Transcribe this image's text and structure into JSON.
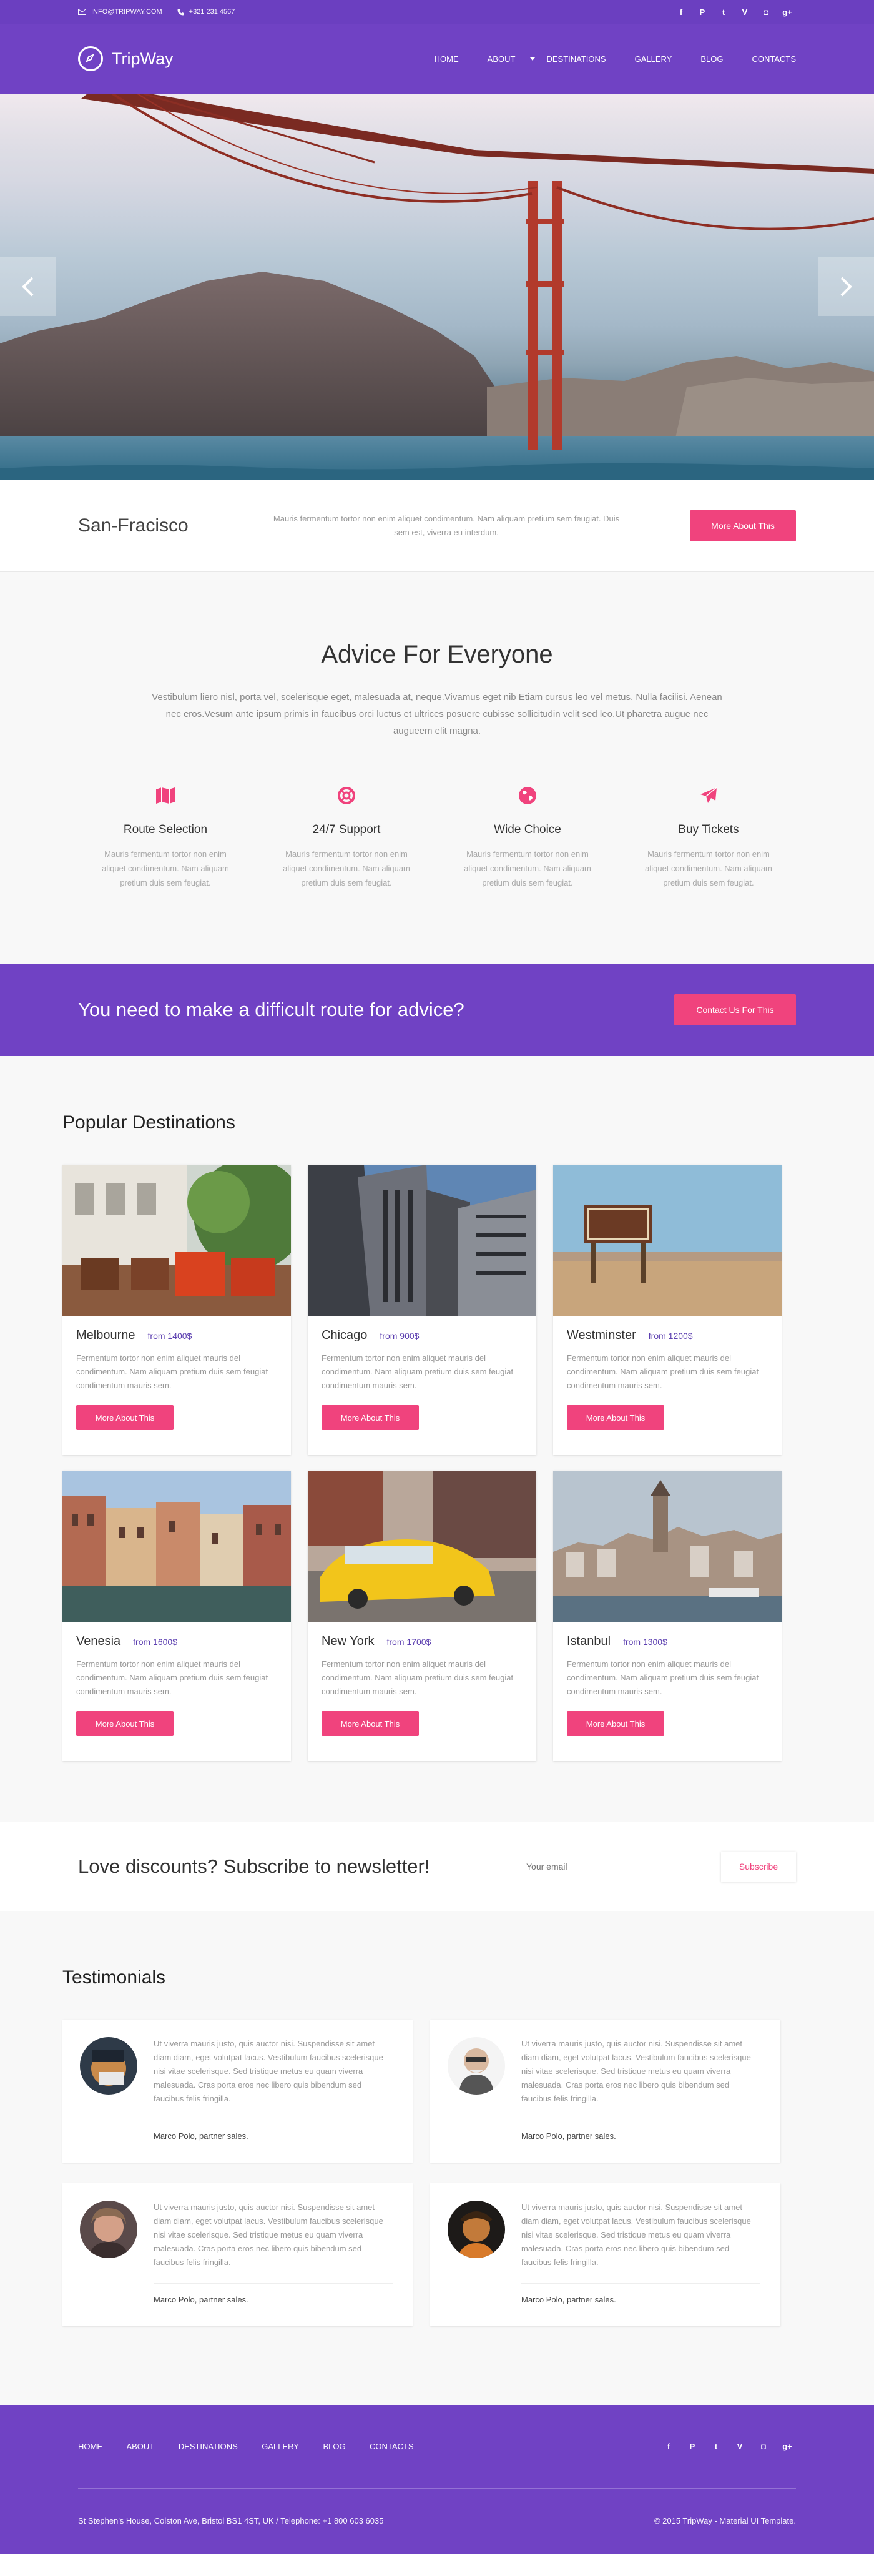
{
  "topbar": {
    "email": "INFO@TRIPWAY.COM",
    "phone": "+321 231 4567",
    "social": [
      {
        "icon": "facebook-icon",
        "glyph": "f"
      },
      {
        "icon": "pinterest-icon",
        "glyph": "P"
      },
      {
        "icon": "twitter-icon",
        "glyph": "t"
      },
      {
        "icon": "vimeo-icon",
        "glyph": "V"
      },
      {
        "icon": "instagram-icon",
        "glyph": "◘"
      },
      {
        "icon": "google-plus-icon",
        "glyph": "g+"
      }
    ]
  },
  "header": {
    "brand": "TripWay",
    "nav": [
      "HOME",
      "ABOUT",
      "DESTINATIONS",
      "GALLERY",
      "BLOG",
      "CONTACTS"
    ]
  },
  "hero": {
    "prev_icon": "chevron-left-icon",
    "next_icon": "chevron-right-icon"
  },
  "city": {
    "name": "San-Fracisco",
    "description": "Mauris fermentum tortor non enim aliquet condimentum. Nam aliquam pretium sem feugiat. Duis sem est, viverra eu interdum.",
    "button": "More About This"
  },
  "advice": {
    "title": "Advice For Everyone",
    "lead": "Vestibulum liero nisl, porta vel, scelerisque eget, malesuada at, neque.Vivamus eget nib Etiam cursus leo vel metus. Nulla facilisi. Aenean nec eros.Vesum ante ipsum primis in faucibus orci luctus et ultrices posuere cubisse sollicitudin velit sed leo.Ut pharetra augue nec augueem elit magna.",
    "features": [
      {
        "icon": "map-icon",
        "title": "Route Selection",
        "text": "Mauris fermentum tortor non enim aliquet condimentum. Nam aliquam pretium duis sem feugiat."
      },
      {
        "icon": "lifebuoy-icon",
        "title": "24/7 Support",
        "text": "Mauris fermentum tortor non enim aliquet condimentum. Nam aliquam pretium duis sem feugiat."
      },
      {
        "icon": "globe-icon",
        "title": "Wide Choice",
        "text": "Mauris fermentum tortor non enim aliquet condimentum. Nam aliquam pretium duis sem feugiat."
      },
      {
        "icon": "airplane-icon",
        "title": "Buy Tickets",
        "text": "Mauris fermentum tortor non enim aliquet condimentum. Nam aliquam pretium duis sem feugiat."
      }
    ]
  },
  "callout": {
    "title": "You need to make a difficult route for advice?",
    "button": "Contact Us For This"
  },
  "destinations": {
    "title": "Popular Destinations",
    "items": [
      {
        "name": "Melbourne",
        "price": "from 1400$",
        "text": "Fermentum tortor non enim aliquet mauris del condimentum. Nam aliquam pretium duis sem feugiat condimentum mauris sem.",
        "button": "More About This"
      },
      {
        "name": "Chicago",
        "price": "from 900$",
        "text": "Fermentum tortor non enim aliquet mauris del condimentum. Nam aliquam pretium duis sem feugiat condimentum mauris sem.",
        "button": "More About This"
      },
      {
        "name": "Westminster",
        "price": "from 1200$",
        "text": "Fermentum tortor non enim aliquet mauris del condimentum. Nam aliquam pretium duis sem feugiat condimentum mauris sem.",
        "button": "More About This"
      },
      {
        "name": "Venesia",
        "price": "from 1600$",
        "text": "Fermentum tortor non enim aliquet mauris del condimentum. Nam aliquam pretium duis sem feugiat condimentum mauris sem.",
        "button": "More About This"
      },
      {
        "name": "New York",
        "price": "from 1700$",
        "text": "Fermentum tortor non enim aliquet mauris del condimentum. Nam aliquam pretium duis sem feugiat condimentum mauris sem.",
        "button": "More About This"
      },
      {
        "name": "Istanbul",
        "price": "from 1300$",
        "text": "Fermentum tortor non enim aliquet mauris del condimentum. Nam aliquam pretium duis sem feugiat condimentum mauris sem.",
        "button": "More About This"
      }
    ]
  },
  "newsletter": {
    "title": "Love discounts? Subscribe to newsletter!",
    "placeholder": "Your email",
    "button": "Subscribe"
  },
  "testimonials": {
    "title": "Testimonials",
    "items": [
      {
        "text": "Ut viverra mauris justo, quis auctor nisi. Suspendisse sit amet diam diam, eget volutpat lacus. Vestibulum faucibus scelerisque nisi vitae scelerisque. Sed tristique metus eu quam viverra malesuada. Cras porta eros nec libero quis bibendum sed faucibus felis fringilla.",
        "author": "Marco Polo, partner sales."
      },
      {
        "text": "Ut viverra mauris justo, quis auctor nisi. Suspendisse sit amet diam diam, eget volutpat lacus. Vestibulum faucibus scelerisque nisi vitae scelerisque. Sed tristique metus eu quam viverra malesuada. Cras porta eros nec libero quis bibendum sed faucibus felis fringilla.",
        "author": "Marco Polo, partner sales."
      },
      {
        "text": "Ut viverra mauris justo, quis auctor nisi. Suspendisse sit amet diam diam, eget volutpat lacus. Vestibulum faucibus scelerisque nisi vitae scelerisque. Sed tristique metus eu quam viverra malesuada. Cras porta eros nec libero quis bibendum sed faucibus felis fringilla.",
        "author": "Marco Polo, partner sales."
      },
      {
        "text": "Ut viverra mauris justo, quis auctor nisi. Suspendisse sit amet diam diam, eget volutpat lacus. Vestibulum faucibus scelerisque nisi vitae scelerisque. Sed tristique metus eu quam viverra malesuada. Cras porta eros nec libero quis bibendum sed faucibus felis fringilla.",
        "author": "Marco Polo, partner sales."
      }
    ]
  },
  "footer": {
    "nav": [
      "HOME",
      "ABOUT",
      "DESTINATIONS",
      "GALLERY",
      "BLOG",
      "CONTACTS"
    ],
    "address": "St Stephen's House, Colston Ave, Bristol BS1 4ST, UK  /  Telephone: +1 800 603 6035",
    "copyright": "© 2015 TripWay - Material UI Template."
  },
  "colors": {
    "brand_purple": "#7042c4",
    "topbar_purple": "#6b3fc0",
    "accent_pink": "#f0437d",
    "price_purple": "#5c3fb0"
  }
}
